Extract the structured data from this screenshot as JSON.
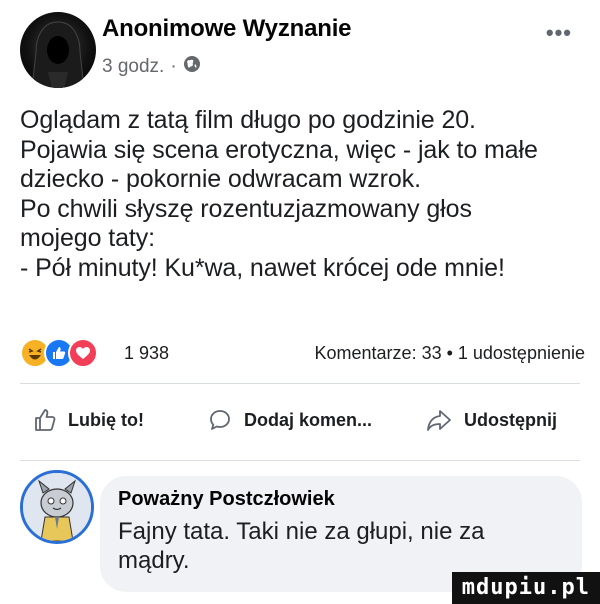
{
  "post": {
    "author": "Anonimowe Wyznanie",
    "time": "3 godz.",
    "separator": "·",
    "more_label": "•••",
    "text_lines": [
      "Oglądam z tatą film długo po godzinie 20.",
      "Pojawia się scena erotyczna, więc - jak to małe",
      "dziecko - pokornie odwracam wzrok.",
      "Po chwili słyszę rozentuzjazmowany głos",
      "mojego taty:",
      "- Pół minuty! Ku*wa, nawet krócej ode mnie!"
    ]
  },
  "stats": {
    "reaction_icons": [
      "haha-icon",
      "like-icon",
      "love-icon"
    ],
    "reaction_count": "1 938",
    "comments_shares": "Komentarze: 33 • 1 udostępnienie"
  },
  "actions": {
    "like_label": "Lubię to!",
    "comment_label": "Dodaj komen...",
    "share_label": "Udostępnij"
  },
  "comment": {
    "author": "Poważny Postczłowiek",
    "text_lines": [
      "Fajny tata. Taki nie za głupi, nie za",
      "mądry."
    ]
  },
  "watermark": "mdupiu.pl",
  "colors": {
    "facebook_blue": "#1877f2",
    "love_red": "#f33e58",
    "haha_yellow": "#f7b125",
    "secondary_text": "#65676b",
    "bubble_bg": "#f0f2f5"
  }
}
